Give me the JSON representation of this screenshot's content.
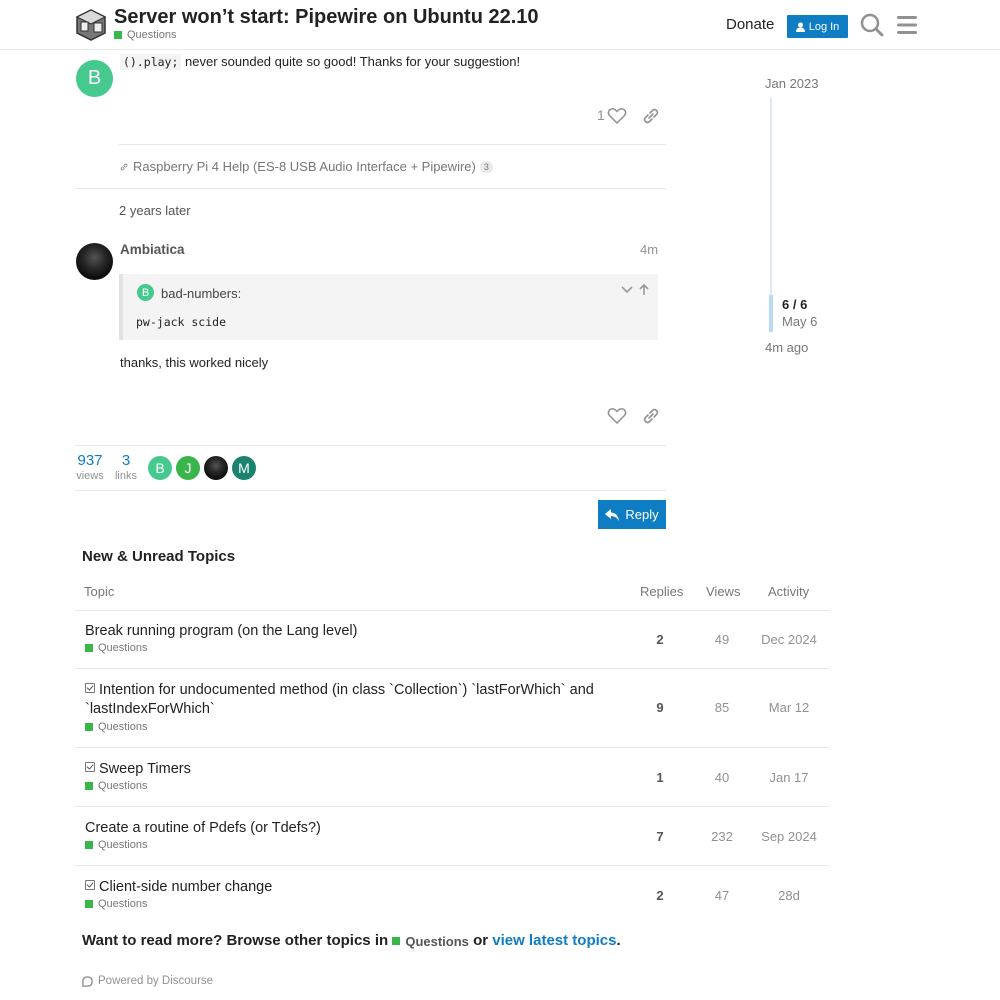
{
  "header": {
    "title": "Server won’t start: Pipewire on Ubuntu 22.10",
    "category": "Questions",
    "donate": "Donate",
    "login": "Log In"
  },
  "post1": {
    "code": "().play;",
    "text": "never sounded quite so good! Thanks for your suggestion!",
    "avatar_letter": "B",
    "like_count": "1"
  },
  "linked_topic": {
    "title": "Raspberry Pi 4 Help (ES-8 USB Audio Interface + Pipewire)",
    "count": "3"
  },
  "time_gap": "2 years later",
  "post2": {
    "author": "Ambiatica",
    "time": "4m",
    "quote_avatar": "B",
    "quote_author": "bad-numbers:",
    "quote_code": "pw-jack scide",
    "text": "thanks, this worked nicely"
  },
  "timeline": {
    "start": "Jan 2023",
    "position": "6 / 6",
    "date": "May 6",
    "end": "4m ago"
  },
  "stats": {
    "views": "937",
    "views_label": "views",
    "links": "3",
    "links_label": "links",
    "participants": [
      {
        "letter": "B",
        "color": "#45c98f"
      },
      {
        "letter": "J",
        "color": "#3ab54a"
      },
      {
        "letter": "",
        "color": "#1a1a1a"
      },
      {
        "letter": "M",
        "color": "#1c8270"
      }
    ]
  },
  "reply": "Reply",
  "suggested": {
    "title": "New & Unread Topics",
    "headers": {
      "topic": "Topic",
      "replies": "Replies",
      "views": "Views",
      "activity": "Activity"
    },
    "topics": [
      {
        "title": "Break running program (on the Lang level)",
        "category": "Questions",
        "replies": "2",
        "views": "49",
        "activity": "Dec 2024",
        "closed": false
      },
      {
        "title": "Intention for undocumented method (in class `Collection`) `lastForWhich` and `lastIndexForWhich`",
        "category": "Questions",
        "replies": "9",
        "views": "85",
        "activity": "Mar 12",
        "closed": true
      },
      {
        "title": "Sweep Timers",
        "category": "Questions",
        "replies": "1",
        "views": "40",
        "activity": "Jan 17",
        "closed": true
      },
      {
        "title": "Create a routine of Pdefs (or Tdefs?)",
        "category": "Questions",
        "replies": "7",
        "views": "232",
        "activity": "Sep 2024",
        "closed": false
      },
      {
        "title": "Client-side number change",
        "category": "Questions",
        "replies": "2",
        "views": "47",
        "activity": "28d",
        "closed": true
      }
    ]
  },
  "footer": {
    "more_prefix": "Want to read more? Browse other topics in",
    "category": "Questions",
    "or": "or",
    "latest": "view latest topics",
    "period": ".",
    "powered": "Powered by Discourse"
  },
  "colors": {
    "accent": "#0e7dc3",
    "category": "#3ab54a"
  }
}
